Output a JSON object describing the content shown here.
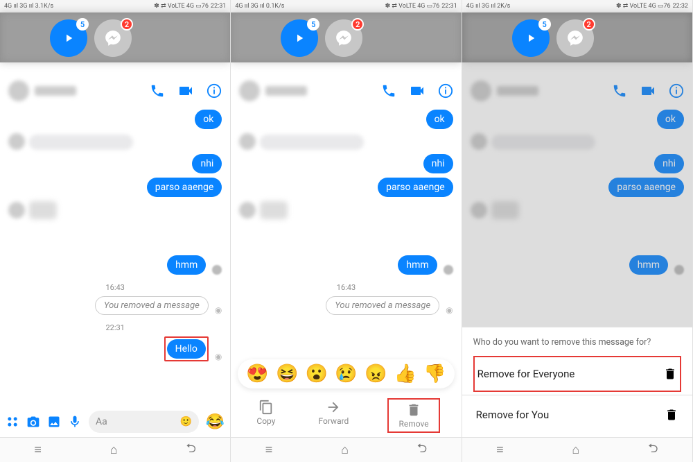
{
  "status": {
    "net_left_a": "4G ııl 3G ııl 3.1K/s",
    "net_left_b": "4G ııl 3G ııl 0.1K/s",
    "net_left_c": "4G ııl 3G ııl 2K/s",
    "time_a": "22:31",
    "time_b": "22:31",
    "time_c": "22:32",
    "right": "✽ ⇄ VoLTE 4G  ▭76"
  },
  "overlay": {
    "play_badge": "5",
    "msgr_badge": "2"
  },
  "messages": {
    "ok": "ok",
    "nhi": "nhi",
    "parso": "parso aaenge",
    "hmm": "hmm",
    "removed": "You removed a message",
    "hello": "Hello",
    "ts1": "16:43",
    "ts2": "22:31"
  },
  "input": {
    "placeholder": "Aa"
  },
  "actions": {
    "copy": "Copy",
    "forward": "Forward",
    "remove": "Remove"
  },
  "sheet": {
    "title": "Who do you want to remove this message for?",
    "opt1": "Remove for Everyone",
    "opt2": "Remove for You"
  },
  "reactions": {
    "r1": "😍",
    "r2": "😆",
    "r3": "😮",
    "r4": "😢",
    "r5": "😠",
    "r6": "👍",
    "r7": "👎"
  }
}
